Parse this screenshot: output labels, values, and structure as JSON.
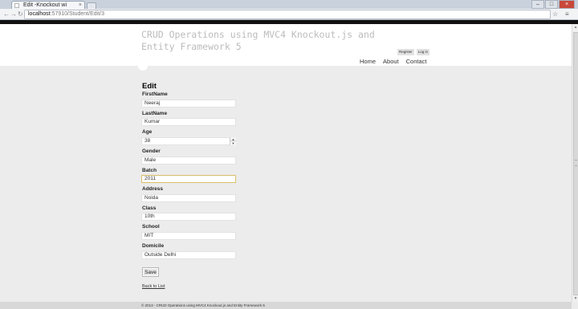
{
  "browser": {
    "tab_title": "Edit -Knockout wi",
    "tab_close": "×",
    "nav": {
      "back": "←",
      "forward": "→",
      "reload": "↻"
    },
    "url_host": "localhost",
    "url_path": ":57910/Student/Edit/3",
    "bookmark_icon": "☆",
    "menu_icon": "≡",
    "window": {
      "minimize": "–",
      "maximize": "□",
      "close": "×"
    }
  },
  "site": {
    "title": "CRUD Operations using MVC4 Knockout.js and Entity Framework 5",
    "register": "Register",
    "login": "Log in",
    "nav": [
      "Home",
      "About",
      "Contact"
    ]
  },
  "page": {
    "heading": "Edit",
    "fields": [
      {
        "label": "FirstName",
        "value": "Neeraj"
      },
      {
        "label": "LastName",
        "value": "Kumar"
      },
      {
        "label": "Age",
        "value": "38"
      },
      {
        "label": "Gender",
        "value": "Male"
      },
      {
        "label": "Batch",
        "value": "2011"
      },
      {
        "label": "Address",
        "value": "Noida"
      },
      {
        "label": "Class",
        "value": "10th"
      },
      {
        "label": "School",
        "value": "MIT"
      },
      {
        "label": "Domicile",
        "value": "Outside Delhi"
      }
    ],
    "stepper": {
      "up": "▲",
      "down": "▼"
    },
    "save_label": "Save",
    "back_label": "Back to List"
  },
  "footer": {
    "text": "© 2013 - CRUD Operations using MVC4 Knockout.js and Entity Framework 5"
  },
  "scrollbar": {
    "up": "▲",
    "down": "▼"
  }
}
